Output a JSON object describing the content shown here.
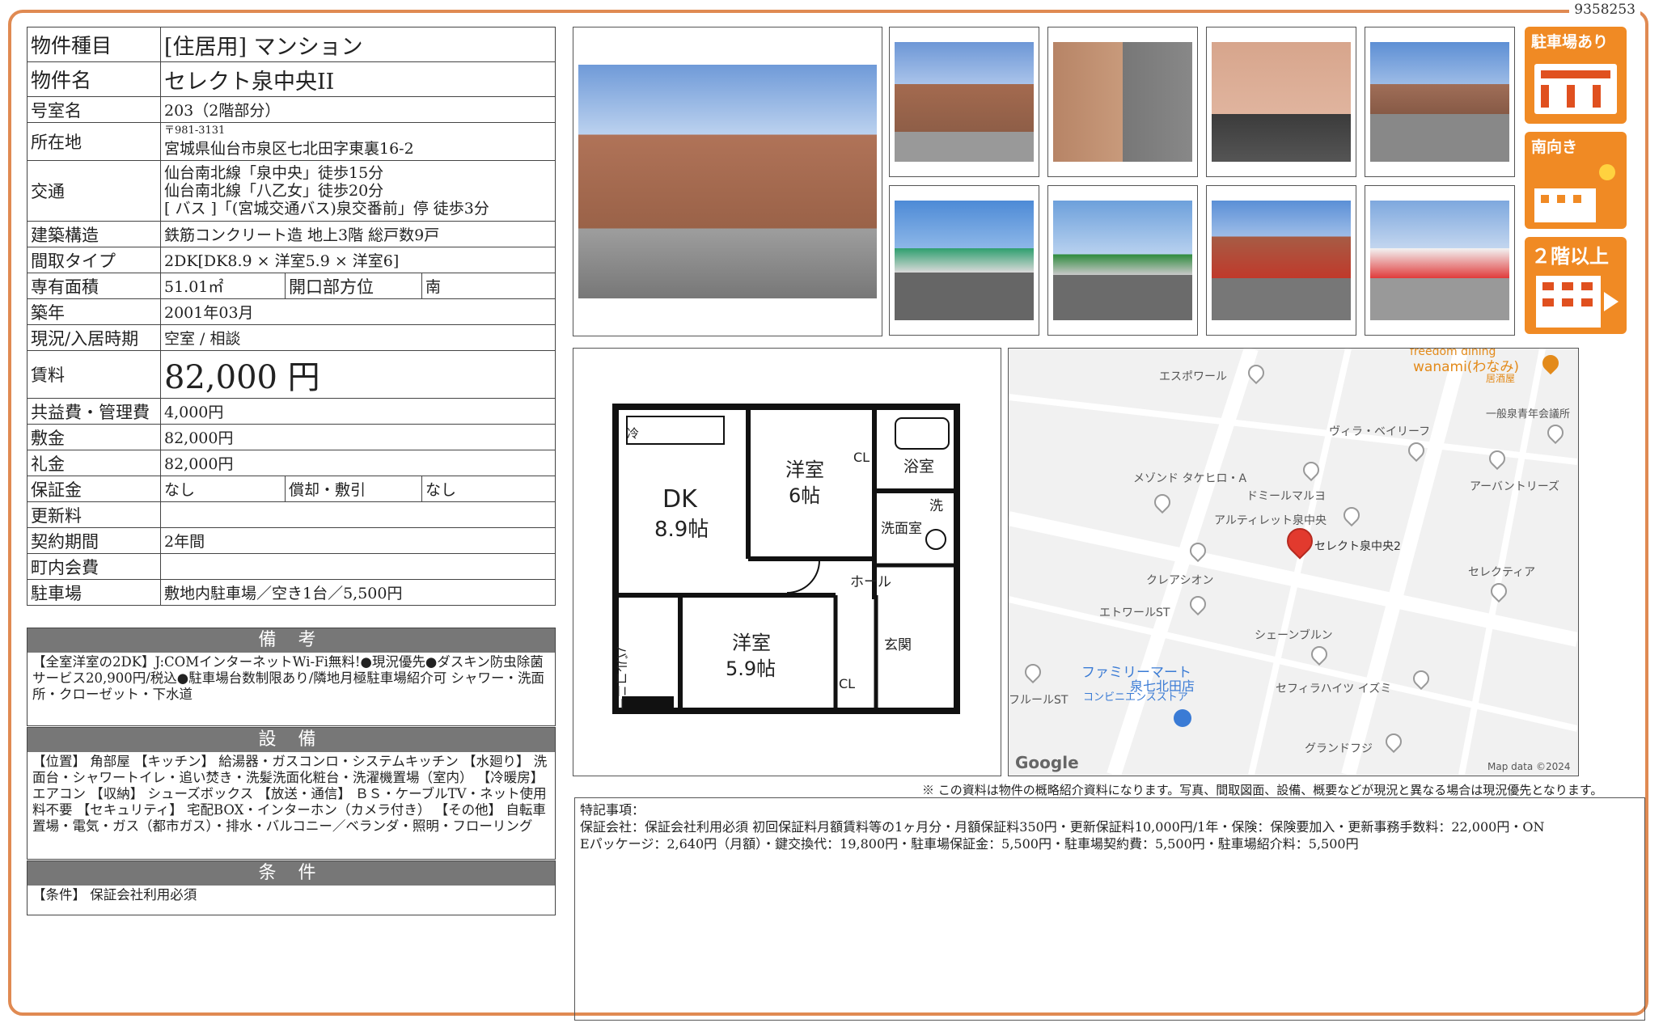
{
  "doc_number": "9358253",
  "spec": {
    "type_label": "物件種目",
    "type_value": "[住居用] マンション",
    "name_label": "物件名",
    "name_value": "セレクト泉中央II",
    "room_label": "号室名",
    "room_value": "203（2階部分）",
    "address_label": "所在地",
    "address_zip": "〒981-3131",
    "address_value": "宮城県仙台市泉区七北田字東裏16-2",
    "access_label": "交通",
    "access_1": "仙台南北線「泉中央」徒歩15分",
    "access_2": "仙台南北線「八乙女」徒歩20分",
    "access_3": "[ バス ]「(宮城交通バス)泉交番前」停 徒歩3分",
    "structure_label": "建築構造",
    "structure_value": "鉄筋コンクリート造 地上3階 総戸数9戸",
    "layout_label": "間取タイプ",
    "layout_value": "2DK[DK8.9 × 洋室5.9 × 洋室6]",
    "area_label": "専有面積",
    "area_value": "51.01㎡",
    "direction_label": "開口部方位",
    "direction_value": "南",
    "built_label": "築年",
    "built_value": "2001年03月",
    "status_label": "現況/入居時期",
    "status_value": "空室 / 相談",
    "rent_label": "賃料",
    "rent_value": "82,000 円",
    "fee_label": "共益費・管理費",
    "fee_value": "4,000円",
    "deposit_label": "敷金",
    "deposit_value": "82,000円",
    "key_money_label": "礼金",
    "key_money_value": "82,000円",
    "guarantee_label": "保証金",
    "guarantee_value": "なし",
    "amort_label": "償却・敷引",
    "amort_value": "なし",
    "renewal_label": "更新料",
    "renewal_value": "",
    "contract_label": "契約期間",
    "contract_value": "2年間",
    "community_label": "町内会費",
    "community_value": "",
    "parking_label": "駐車場",
    "parking_value": "敷地内駐車場／空き1台／5,500円"
  },
  "remarks": {
    "heading": "備 考",
    "body": "【全室洋室の2DK】J:COMインターネットWi-Fi無料!●現況優先●ダスキン防虫除菌サービス20,900円/税込●駐車場台数制限あり/隣地月極駐車場紹介可 シャワー・洗面所・クローゼット・下水道"
  },
  "facilities": {
    "heading": "設 備",
    "body": "【位置】 角部屋 【キッチン】 給湯器・ガスコンロ・システムキッチン 【水廻り】 洗面台・シャワートイレ・追い焚き・洗髪洗面化粧台・洗濯機置場（室内） 【冷暖房】 エアコン 【収納】 シューズボックス 【放送・通信】 ＢＳ・ケーブルTV・ネット使用料不要 【セキュリティ】 宅配BOX・インターホン（カメラ付き） 【その他】 自転車置場・電気・ガス（都市ガス）・排水・バルコニー／ベランダ・照明・フローリング"
  },
  "conditions": {
    "heading": "条 件",
    "body": "【条件】 保証会社利用必須"
  },
  "badges": {
    "parking": "駐車場あり",
    "south": "南向き",
    "floor2": "２階以上"
  },
  "floorplan": {
    "dk": "DK",
    "dk_size": "8.9帖",
    "room1": "洋室",
    "room1_size": "6帖",
    "room2": "洋室",
    "room2_size": "5.9帖",
    "bath": "浴室",
    "wash": "洗面室",
    "hall": "ホール",
    "entrance": "玄関",
    "balcony": "バルコニー",
    "cl": "CL",
    "fridge": "冷",
    "washer": "洗"
  },
  "map": {
    "labels": [
      "エスポワール",
      "一般泉青年会議所",
      "ヴィラ・ベイリーフ",
      "メゾンド タケヒロ・A",
      "ドミールマルヨ",
      "アーバントリーズ",
      "アルティレット泉中央",
      "セレクト泉中央2",
      "クレアシオン",
      "セレクティア",
      "エトワールST",
      "シェーンブルン",
      "ファミリーマート",
      "泉七北田店",
      "コンビニエンスストア",
      "セフィラハイツ イズミ",
      "グランドフジ",
      "フルールST",
      "wanami(わなみ)",
      "居酒屋",
      "freedom dining"
    ],
    "google": "Google",
    "attribution": "Map data ©2024"
  },
  "disclaimer": "※ この資料は物件の概略紹介資料になります。写真、間取図面、設備、概要などが現況と異なる場合は現況優先となります。",
  "special": {
    "heading": "特記事項：",
    "line1": "保証会社：保証会社利用必須 初回保証料月額賃料等の1ヶ月分・月額保証料350円・更新保証料10,000円/1年・保険：保険要加入・更新事務手数料：22,000円・ON",
    "line2": "Eパッケージ：2,640円（月額）・鍵交換代：19,800円・駐車場保証金：5,500円・駐車場契約費：5,500円・駐車場紹介料：5,500円"
  },
  "colors": {
    "frame": "#e08a52",
    "badge": "#f08a24",
    "section_header": "#777777"
  }
}
